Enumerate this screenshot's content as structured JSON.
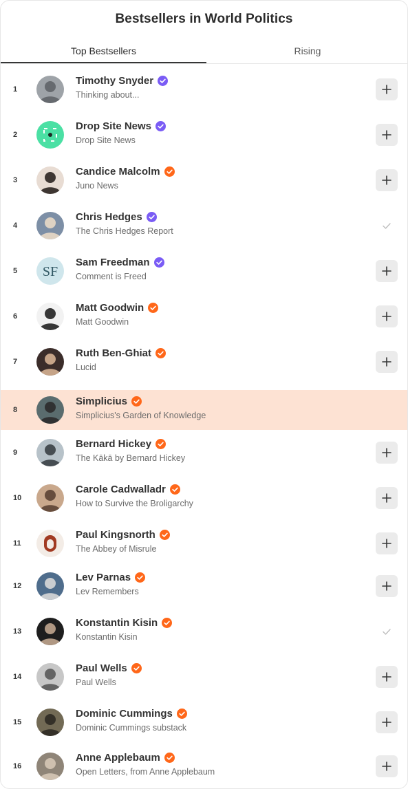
{
  "header": {
    "title": "Bestsellers in World Politics"
  },
  "tabs": [
    {
      "label": "Top Bestsellers",
      "active": true
    },
    {
      "label": "Rising",
      "active": false
    }
  ],
  "colors": {
    "badge_purple": "#7a5cf5",
    "badge_orange": "#ff6719",
    "highlight": "#fde2d3"
  },
  "items": [
    {
      "rank": "1",
      "name": "Timothy Snyder",
      "publication": "Thinking about...",
      "badge": "purple",
      "action": "add",
      "highlighted": false
    },
    {
      "rank": "2",
      "name": "Drop Site News",
      "publication": "Drop Site News",
      "badge": "purple",
      "action": "add",
      "highlighted": false
    },
    {
      "rank": "3",
      "name": "Candice Malcolm",
      "publication": "Juno News",
      "badge": "orange",
      "action": "add",
      "highlighted": false
    },
    {
      "rank": "4",
      "name": "Chris Hedges",
      "publication": "The Chris Hedges Report",
      "badge": "purple",
      "action": "subscribed",
      "highlighted": false
    },
    {
      "rank": "5",
      "name": "Sam Freedman",
      "publication": "Comment is Freed",
      "badge": "purple",
      "action": "add",
      "highlighted": false
    },
    {
      "rank": "6",
      "name": "Matt Goodwin",
      "publication": "Matt Goodwin",
      "badge": "orange",
      "action": "add",
      "highlighted": false
    },
    {
      "rank": "7",
      "name": "Ruth Ben-Ghiat",
      "publication": "Lucid",
      "badge": "orange",
      "action": "add",
      "highlighted": false
    },
    {
      "rank": "8",
      "name": "Simplicius",
      "publication": "Simplicius's Garden of Knowledge",
      "badge": "orange",
      "action": "none",
      "highlighted": true
    },
    {
      "rank": "9",
      "name": "Bernard Hickey",
      "publication": "The Kākā by Bernard Hickey",
      "badge": "orange",
      "action": "add",
      "highlighted": false
    },
    {
      "rank": "10",
      "name": "Carole Cadwalladr",
      "publication": "How to Survive the Broligarchy",
      "badge": "orange",
      "action": "add",
      "highlighted": false
    },
    {
      "rank": "11",
      "name": "Paul Kingsnorth",
      "publication": "The Abbey of Misrule",
      "badge": "orange",
      "action": "add",
      "highlighted": false
    },
    {
      "rank": "12",
      "name": "Lev Parnas",
      "publication": "Lev Remembers",
      "badge": "orange",
      "action": "add",
      "highlighted": false
    },
    {
      "rank": "13",
      "name": "Konstantin Kisin",
      "publication": "Konstantin Kisin",
      "badge": "orange",
      "action": "subscribed",
      "highlighted": false
    },
    {
      "rank": "14",
      "name": "Paul Wells",
      "publication": "Paul Wells",
      "badge": "orange",
      "action": "add",
      "highlighted": false
    },
    {
      "rank": "15",
      "name": "Dominic Cummings",
      "publication": "Dominic Cummings substack",
      "badge": "orange",
      "action": "add",
      "highlighted": false
    },
    {
      "rank": "16",
      "name": "Anne Applebaum",
      "publication": "Open Letters, from Anne Applebaum",
      "badge": "orange",
      "action": "add",
      "highlighted": false
    }
  ]
}
